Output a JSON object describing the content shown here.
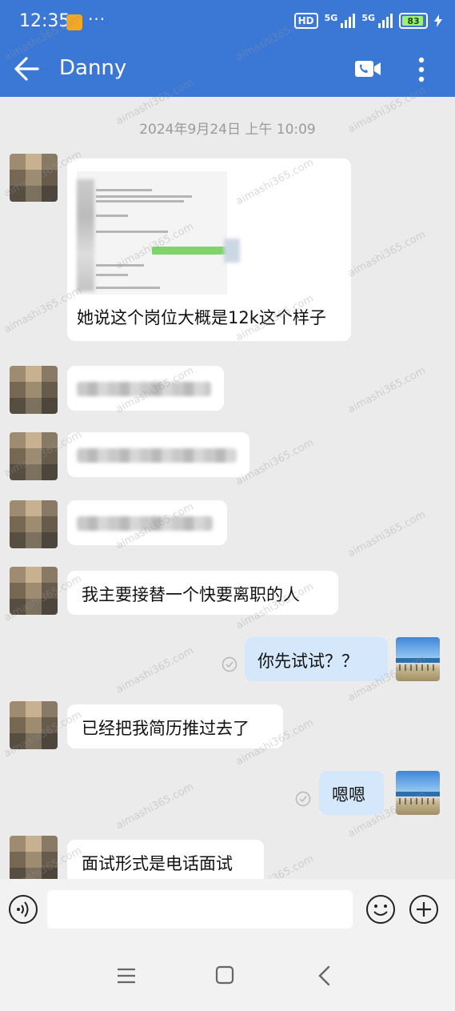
{
  "status_bar": {
    "time": "12:35",
    "extra": "···",
    "hd_label": "HD",
    "net1": "5G",
    "net2": "5G",
    "battery": "83",
    "battery_level": 0.83
  },
  "app_bar": {
    "title": "Danny"
  },
  "date_stamp": "2024年9月24日  上午 10:09",
  "messages": [
    {
      "from": "other",
      "text": "她说这个岗位大概是12k这个样子"
    },
    {
      "from": "other",
      "text": ""
    },
    {
      "from": "other",
      "text": ""
    },
    {
      "from": "other",
      "text": ""
    },
    {
      "from": "other",
      "text": "我主要接替一个快要离职的人"
    },
    {
      "from": "me",
      "text": "你先试试？？"
    },
    {
      "from": "other",
      "text": "已经把我简历推过去了"
    },
    {
      "from": "me",
      "text": "嗯嗯"
    },
    {
      "from": "other",
      "text": "面试形式是电话面试"
    }
  ],
  "watermark": "aimashi365.com",
  "colors": {
    "app_bar": "#3b78d6",
    "my_bubble": "#d5e8fb",
    "background": "#ebebeb"
  }
}
